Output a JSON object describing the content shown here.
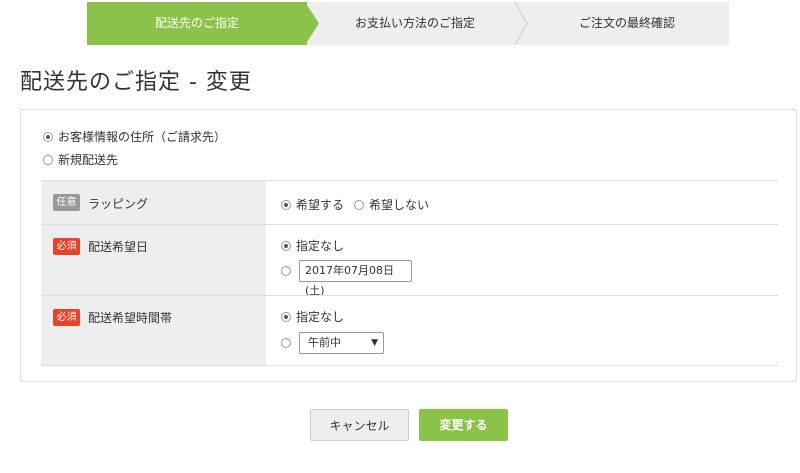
{
  "stepper": {
    "steps": [
      {
        "label": "配送先のご指定",
        "active": true
      },
      {
        "label": "お支払い方法のご指定",
        "active": false
      },
      {
        "label": "ご注文の最終確認",
        "active": false
      }
    ]
  },
  "page_title": "配送先のご指定 - 変更",
  "address_options": [
    {
      "label": "お客様情報の住所（ご請求先）",
      "checked": true
    },
    {
      "label": "新規配送先",
      "checked": false
    }
  ],
  "rows": {
    "wrapping": {
      "badge": "任意",
      "label": "ラッピング",
      "options": [
        {
          "label": "希望する",
          "checked": true
        },
        {
          "label": "希望しない",
          "checked": false
        }
      ]
    },
    "delivery_date": {
      "badge": "必須",
      "label": "配送希望日",
      "none_label": "指定なし",
      "none_checked": true,
      "date_value": "2017年07月08日(土)"
    },
    "delivery_time": {
      "badge": "必須",
      "label": "配送希望時間帯",
      "none_label": "指定なし",
      "none_checked": true,
      "select_value": "午前中"
    }
  },
  "buttons": {
    "cancel": "キャンセル",
    "submit": "変更する"
  },
  "colors": {
    "accent": "#8bc34a",
    "required": "#e8412c",
    "optional": "#999999"
  }
}
